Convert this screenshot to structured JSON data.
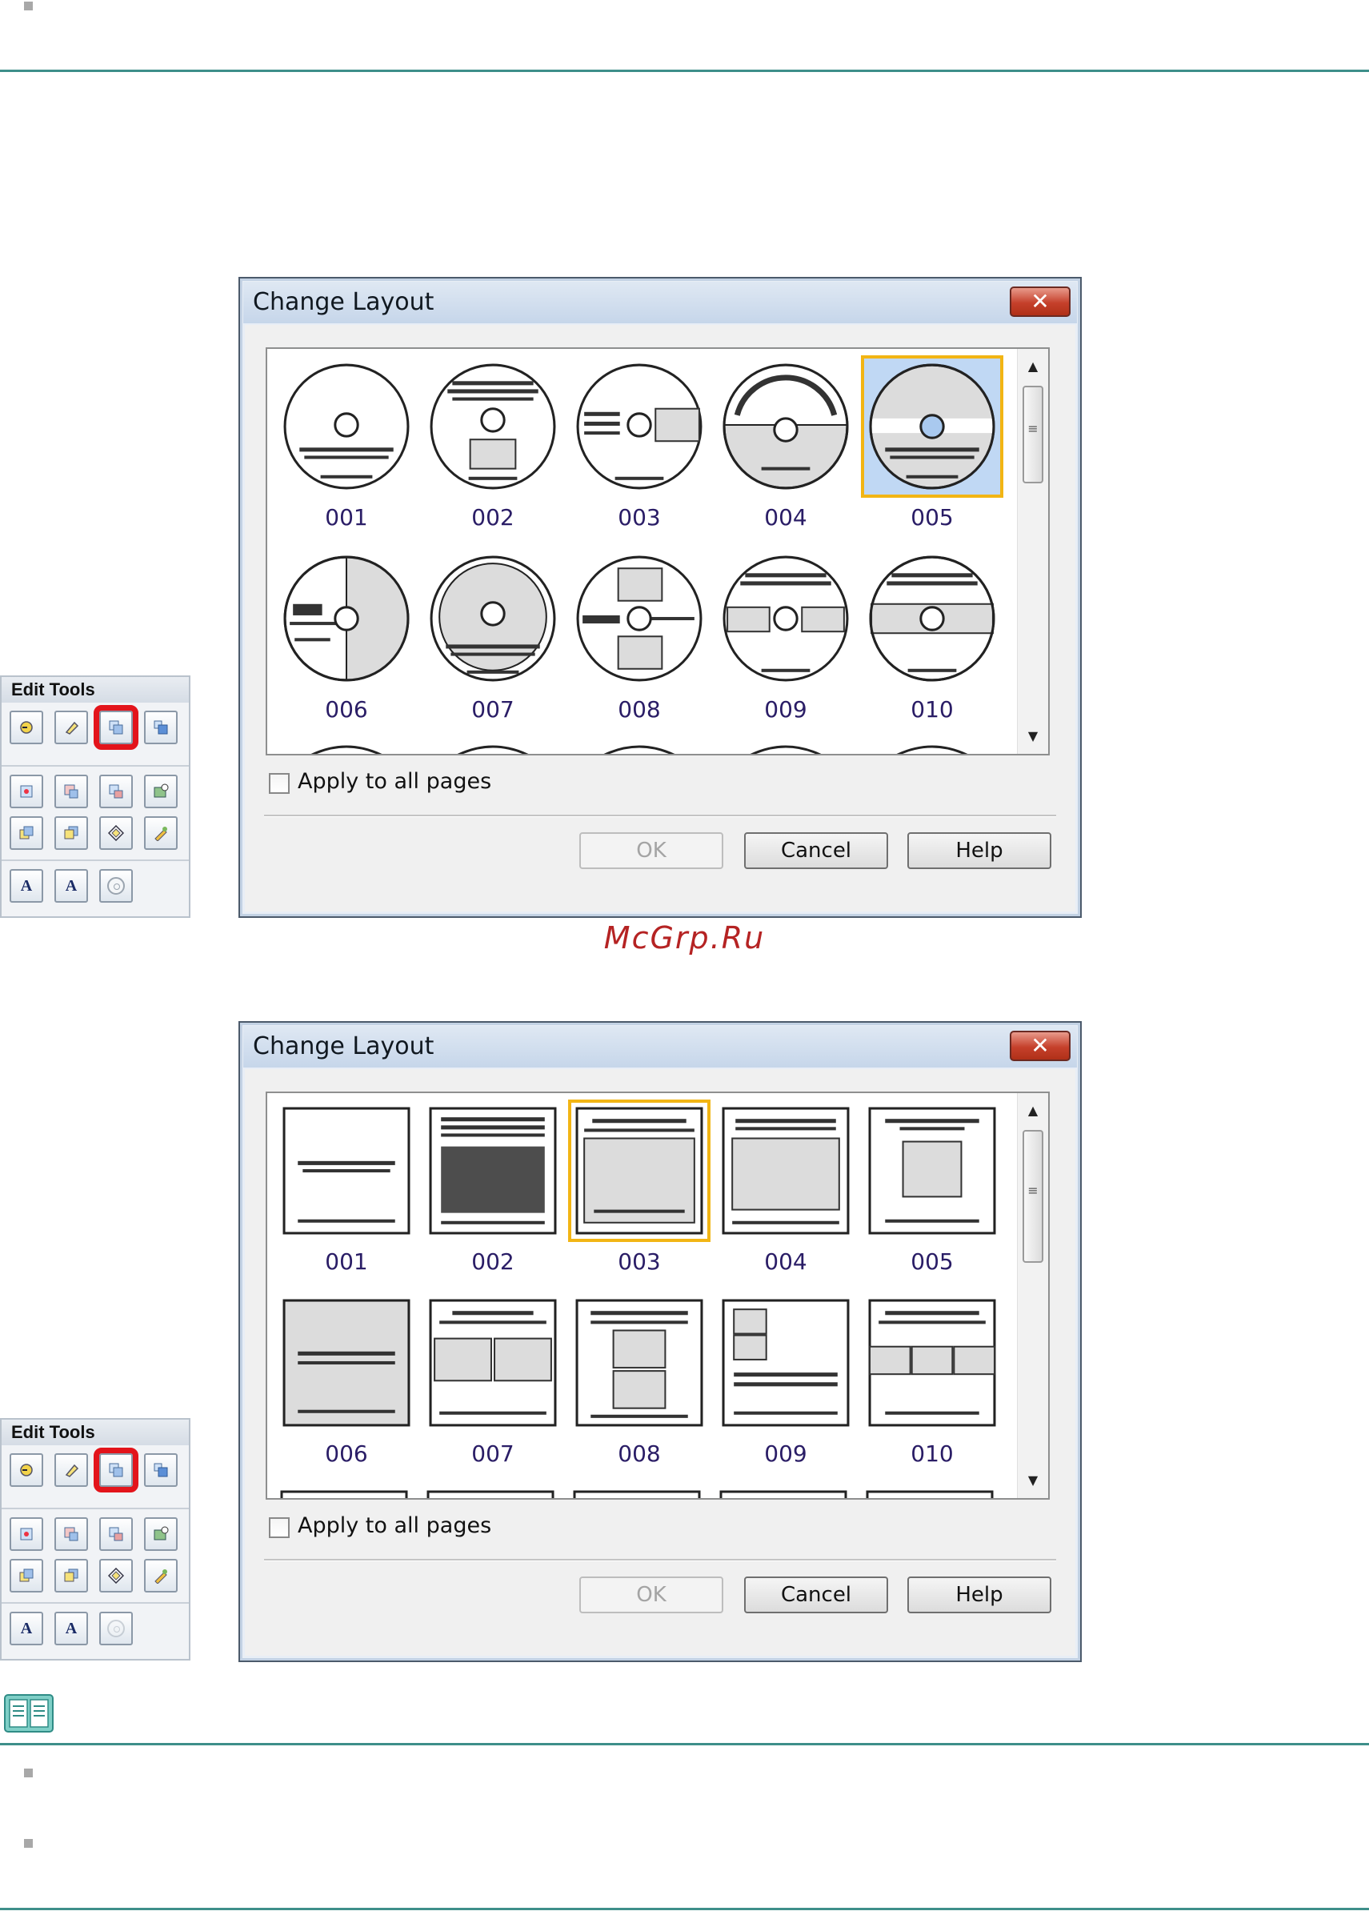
{
  "palette_title": "Edit Tools",
  "dialog": {
    "title": "Change Layout",
    "close_label": "✕",
    "apply_all_label": "Apply to all pages",
    "ok_label": "OK",
    "cancel_label": "Cancel",
    "help_label": "Help"
  },
  "dialog1_items": [
    "001",
    "002",
    "003",
    "004",
    "005",
    "006",
    "007",
    "008",
    "009",
    "010"
  ],
  "dialog1_selected": "005",
  "dialog2_items": [
    "001",
    "002",
    "003",
    "004",
    "005",
    "006",
    "007",
    "008",
    "009",
    "010"
  ],
  "dialog2_selected": "003",
  "palette_text_tools": [
    "A",
    "A"
  ],
  "watermark": "McGrp.Ru",
  "colors": {
    "accent_rule": "#3e8f8a",
    "selection_border": "#f2b514",
    "palette_highlight": "#e3141b",
    "watermark": "#b52323"
  }
}
